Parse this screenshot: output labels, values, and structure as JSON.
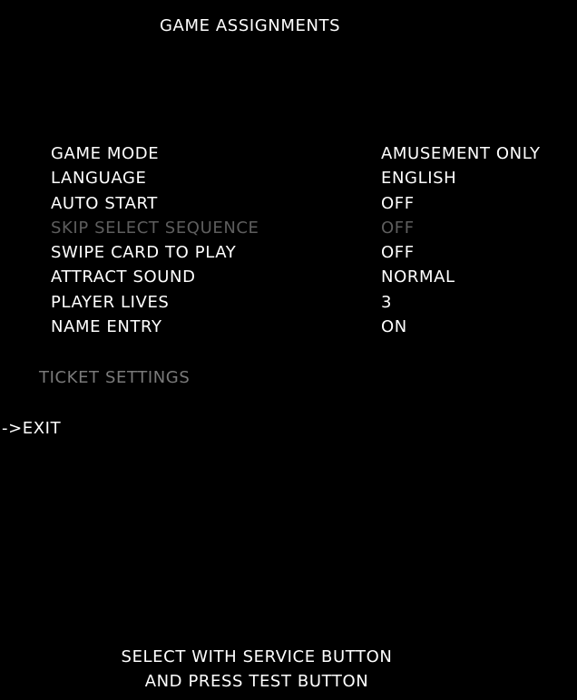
{
  "screen": {
    "title": "GAME ASSIGNMENTS",
    "colors": {
      "background": "#000000",
      "text": "#ffffff",
      "disabled": "#5e5e5e",
      "dimmed": "#7a7a7a"
    }
  },
  "settings": [
    {
      "label": "GAME MODE",
      "value": "AMUSEMENT ONLY",
      "enabled": true
    },
    {
      "label": "LANGUAGE",
      "value": "ENGLISH",
      "enabled": true
    },
    {
      "label": "AUTO START",
      "value": "OFF",
      "enabled": true
    },
    {
      "label": "SKIP SELECT SEQUENCE",
      "value": "OFF",
      "enabled": false
    },
    {
      "label": "SWIPE CARD TO PLAY",
      "value": "OFF",
      "enabled": true
    },
    {
      "label": "ATTRACT SOUND",
      "value": "NORMAL",
      "enabled": true
    },
    {
      "label": "PLAYER LIVES",
      "value": "3",
      "enabled": true
    },
    {
      "label": "NAME ENTRY",
      "value": "ON",
      "enabled": true
    }
  ],
  "ticket_settings": "TICKET SETTINGS",
  "exit": {
    "cursor": "->",
    "label": "EXIT"
  },
  "footer": {
    "line1": "SELECT WITH SERVICE BUTTON",
    "line2": "AND PRESS TEST BUTTON"
  }
}
